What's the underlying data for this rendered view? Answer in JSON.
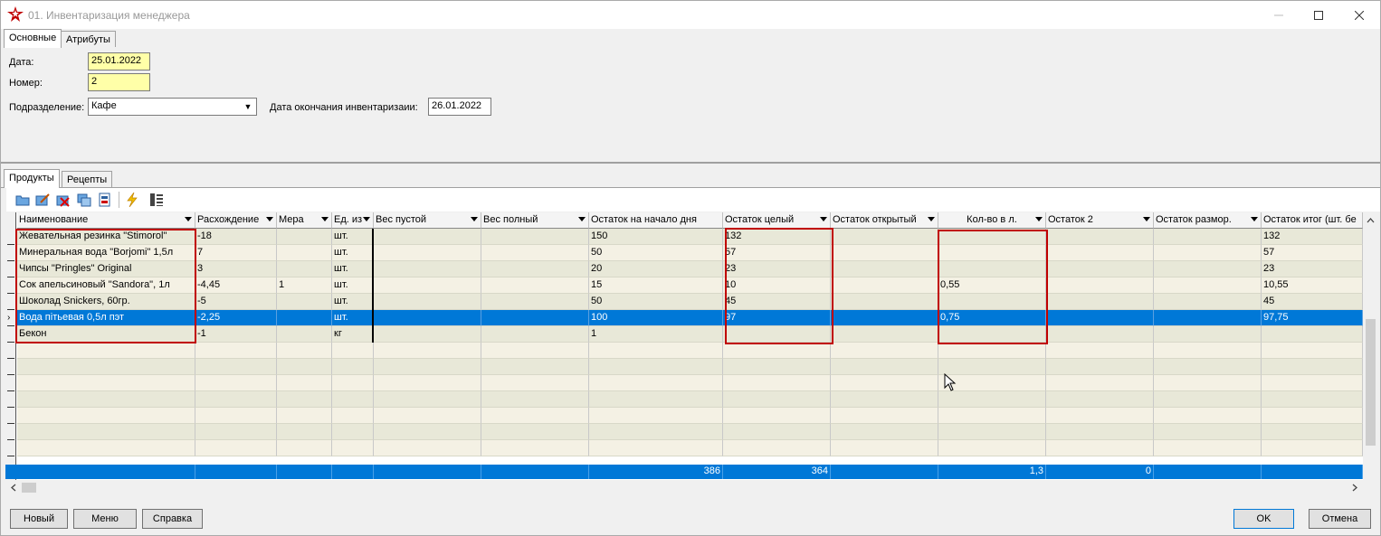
{
  "window": {
    "title": "01. Инвентаризация менеджера"
  },
  "top_tabs": [
    "Основные",
    "Атрибуты"
  ],
  "form": {
    "date_label": "Дата:",
    "date_value": "25.01.2022",
    "number_label": "Номер:",
    "number_value": "2",
    "department_label": "Подразделение:",
    "department_value": "Кафе",
    "end_date_label": "Дата окончания инвентаризаии:",
    "end_date_value": "26.01.2022"
  },
  "bottom_tabs": [
    "Продукты",
    "Рецепты"
  ],
  "toolbar_icons": [
    "folder-open-icon",
    "edit-icon",
    "delete-icon",
    "copy-icon",
    "document-icon",
    "lightning-icon",
    "columns-icon"
  ],
  "columns": [
    "Наименование",
    "Расхождение",
    "Мера",
    "Ед. из",
    "Вес пустой",
    "Вес полный",
    "Остаток на начало дня",
    "Остаток целый",
    "Остаток открытый",
    "Кол-во в л.",
    "Остаток 2",
    "Остаток размор.",
    "Остаток итог (шт. бе"
  ],
  "rows": [
    [
      "Жевательная резинка \"Stimorol\"",
      "-18",
      "",
      "шт.",
      "",
      "",
      "150",
      "132",
      "",
      "",
      "",
      "",
      "132"
    ],
    [
      "Минеральная вода \"Borjomi\" 1,5л",
      "7",
      "",
      "шт.",
      "",
      "",
      "50",
      "57",
      "",
      "",
      "",
      "",
      "57"
    ],
    [
      "Чипсы \"Pringles\" Original",
      "3",
      "",
      "шт.",
      "",
      "",
      "20",
      "23",
      "",
      "",
      "",
      "",
      "23"
    ],
    [
      "Сок апельсиновый \"Sandora\", 1л",
      "-4,45",
      "1",
      "шт.",
      "",
      "",
      "15",
      "10",
      "",
      "0,55",
      "",
      "",
      "10,55"
    ],
    [
      "Шоколад Snickers, 60гр.",
      "-5",
      "",
      "шт.",
      "",
      "",
      "50",
      "45",
      "",
      "",
      "",
      "",
      "45"
    ],
    [
      "Вода пітьевая 0,5л пэт",
      "-2,25",
      "",
      "шт.",
      "",
      "",
      "100",
      "97",
      "",
      "0,75",
      "",
      "",
      "97,75"
    ],
    [
      "Бекон",
      "-1",
      "",
      "кг",
      "",
      "",
      "1",
      "",
      "",
      "",
      "",
      "",
      ""
    ]
  ],
  "selected_row": 5,
  "totals": {
    "start": "386",
    "whole": "364",
    "liters": "1,3",
    "rest2": "0"
  },
  "buttons": {
    "new": "Новый",
    "menu": "Меню",
    "help": "Справка",
    "ok": "OK",
    "cancel": "Отмена"
  },
  "colors": {
    "selection": "#0078d7",
    "highlight_field": "#ffffa8",
    "row_even": "#e8e8d8",
    "row_odd": "#f4f1e4",
    "annotation_box": "#c00000"
  }
}
